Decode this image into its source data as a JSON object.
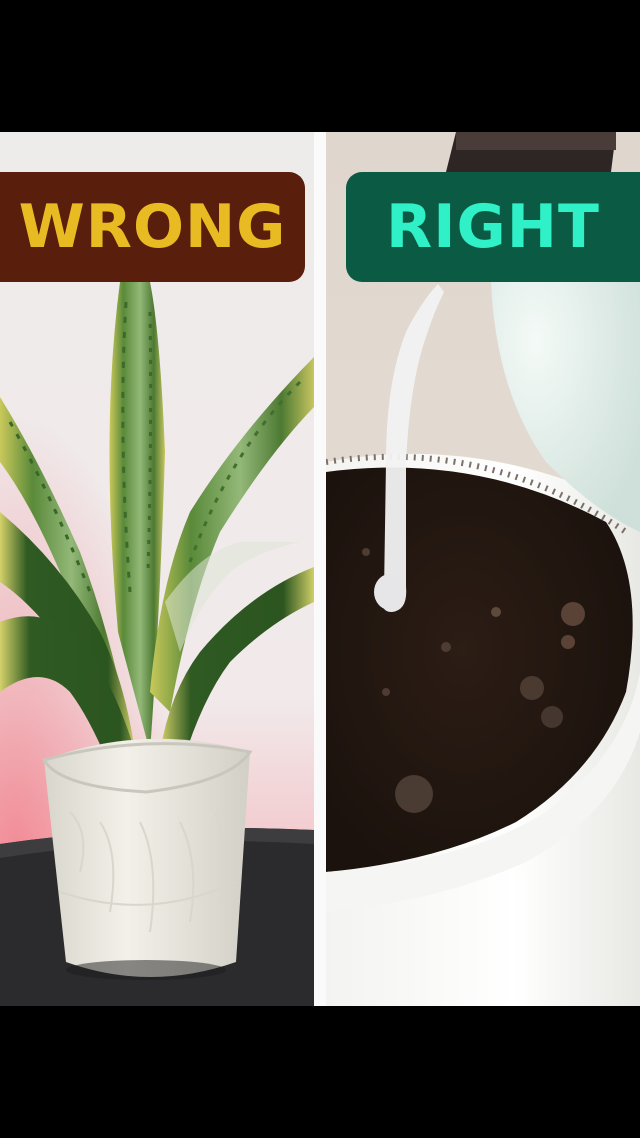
{
  "panels": {
    "left": {
      "label": "WRONG",
      "label_color": "#e9bb22",
      "label_bg": "#5a1e0c"
    },
    "right": {
      "label": "RIGHT",
      "label_color": "#2ff0c6",
      "label_bg": "#0b5a44"
    }
  }
}
